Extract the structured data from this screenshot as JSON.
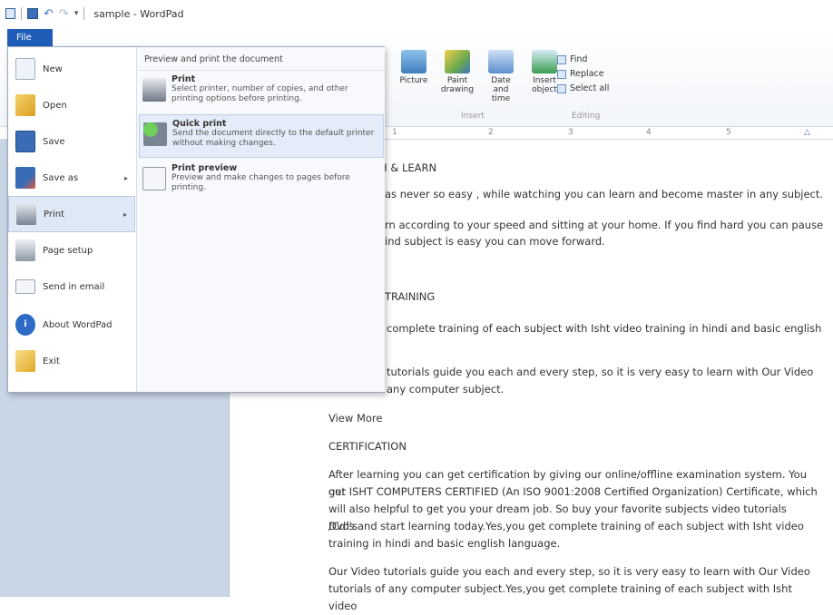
{
  "window": {
    "title": "sample - WordPad",
    "file_tab": "File"
  },
  "ribbon": {
    "insert_buttons": [
      {
        "label": "Picture",
        "icon": "picture-icon",
        "color": "#4a86c5"
      },
      {
        "label": "Paint drawing",
        "icon": "paint-drawing-icon",
        "color": "#6aa84f"
      },
      {
        "label": "Date and time",
        "icon": "calendar-icon",
        "color": "#5b8fd0"
      },
      {
        "label": "Insert object",
        "icon": "insert-object-icon",
        "color": "#3a9c4f"
      }
    ],
    "insert_group": "Insert",
    "editing_items": [
      "Find",
      "Replace",
      "Select all"
    ],
    "editing_group": "Editing",
    "ruler_marks": [
      "1",
      "2",
      "3",
      "4",
      "5"
    ]
  },
  "file_menu": {
    "items": [
      {
        "label": "New",
        "icon": "new-document-icon",
        "color": "#e7eef8"
      },
      {
        "label": "Open",
        "icon": "open-folder-icon",
        "color": "#e8b93a"
      },
      {
        "label": "Save",
        "icon": "save-icon",
        "color": "#3a6bb5"
      },
      {
        "label": "Save as",
        "icon": "save-as-icon",
        "color": "#3a6bb5",
        "has_submenu": true
      },
      {
        "label": "Print",
        "icon": "printer-icon",
        "color": "#7a8594",
        "has_submenu": true,
        "active": true
      },
      {
        "label": "Page setup",
        "icon": "page-setup-icon",
        "color": "#7a8594"
      },
      {
        "label": "Send in email",
        "icon": "email-icon",
        "color": "#d9534f"
      },
      {
        "label": "About WordPad",
        "icon": "info-icon",
        "color": "#2d6bc7"
      },
      {
        "label": "Exit",
        "icon": "exit-icon",
        "color": "#e8b93a"
      }
    ],
    "submenu": {
      "heading": "Preview and print the document",
      "items": [
        {
          "name": "Print",
          "desc": "Select printer, number of copies, and other printing options before printing.",
          "icon": "printer-icon"
        },
        {
          "name": "Quick print",
          "desc": "Send the document directly to the default printer without making changes.",
          "icon": "quick-print-icon",
          "hover": true
        },
        {
          "name": "Print preview",
          "desc": "Preview and make changes to pages before printing.",
          "icon": "print-preview-icon"
        }
      ]
    }
  },
  "document": {
    "paragraphs": [
      "CH & LEARN",
      "as never so easy , while watching you can learn and become master in any subject.",
      "rn according to your speed and sitting at your home. If you find hard you can pause",
      "ind subject is easy you can move forward.",
      "TRAINING",
      "complete training of each subject with Isht video training in hindi and basic english",
      "tutorials guide you each and every step, so it is very easy to learn with Our Video",
      "any computer subject.",
      "View More",
      "CERTIFICATION",
      "After learning you can get certification by giving our online/offline examination system. You get",
      "our ISHT COMPUTERS CERTIFIED (An ISO 9001:2008  Certified Organization) Certificate, which",
      "will also helpful to get you your dream job. So buy your favorite subjects video tutorials Dvd's",
      "/Cd's and start learning today.Yes,you get complete training of each subject with Isht video",
      "training in hindi and basic english language.",
      "Our Video tutorials guide you each and every step, so it is very easy to learn with Our Video",
      "tutorials of any computer subject.Yes,you get complete training of each subject with Isht video"
    ]
  }
}
